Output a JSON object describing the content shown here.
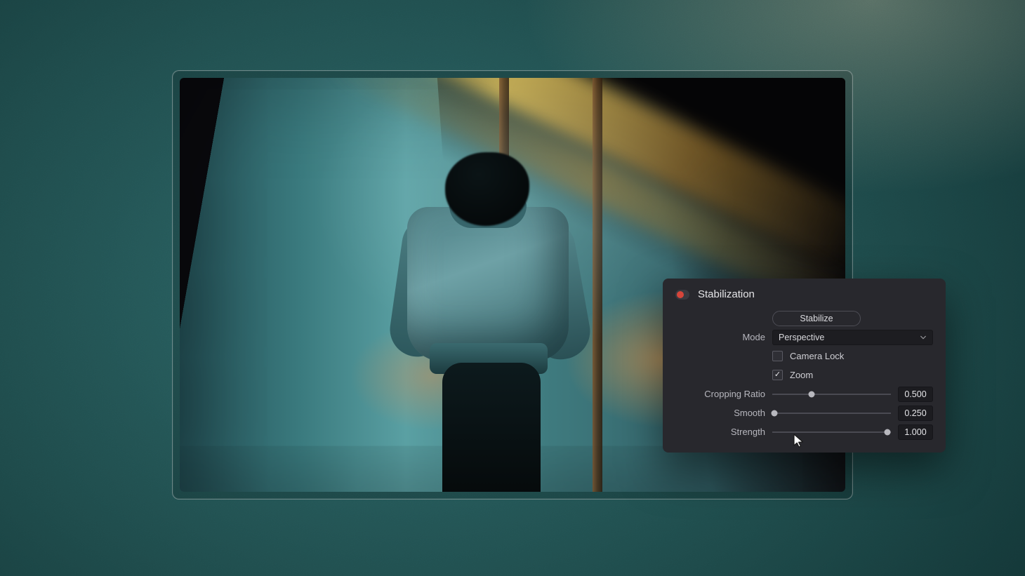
{
  "panel": {
    "title": "Stabilization",
    "enabled": false,
    "stabilize_button": "Stabilize",
    "mode_label": "Mode",
    "mode_value": "Perspective",
    "camera_lock": {
      "label": "Camera Lock",
      "checked": false
    },
    "zoom": {
      "label": "Zoom",
      "checked": true
    },
    "cropping_ratio": {
      "label": "Cropping Ratio",
      "value": "0.500",
      "position": 0.33
    },
    "smooth": {
      "label": "Smooth",
      "value": "0.250",
      "position": 0.02
    },
    "strength": {
      "label": "Strength",
      "value": "1.000",
      "position": 0.97
    }
  },
  "colors": {
    "panel_bg": "#28282d",
    "accent_red": "#d6453a"
  }
}
